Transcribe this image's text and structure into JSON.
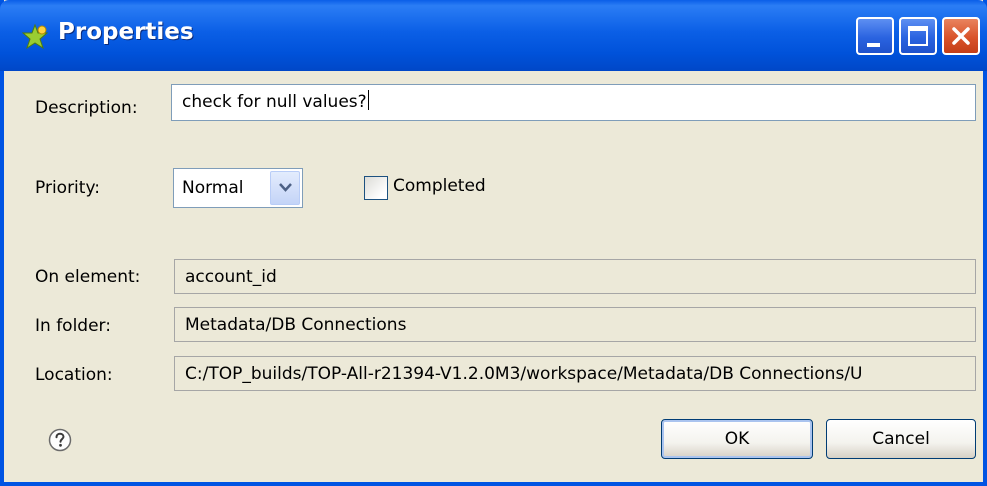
{
  "window": {
    "title": "Properties",
    "title_icon": "green-star-task-icon",
    "controls": [
      "minimize-icon",
      "maximize-icon",
      "close-icon"
    ]
  },
  "form": {
    "description_label": "Description:",
    "description_value": "check for null values?",
    "priority_label": "Priority:",
    "priority_value": "Normal",
    "completed_label": "Completed",
    "completed_checked": false,
    "on_element_label": "On element:",
    "on_element_value": "account_id",
    "in_folder_label": "In folder:",
    "in_folder_value": "Metadata/DB Connections",
    "location_label": "Location:",
    "location_value": "C:/TOP_builds/TOP-All-r21394-V1.2.0M3/workspace/Metadata/DB Connections/U"
  },
  "buttons": {
    "ok_label": "OK",
    "cancel_label": "Cancel"
  },
  "icons": {
    "help": "help-icon"
  },
  "colors": {
    "titlebar": "#0054e3",
    "background": "#ece9d8",
    "close_button": "#d9532a"
  }
}
